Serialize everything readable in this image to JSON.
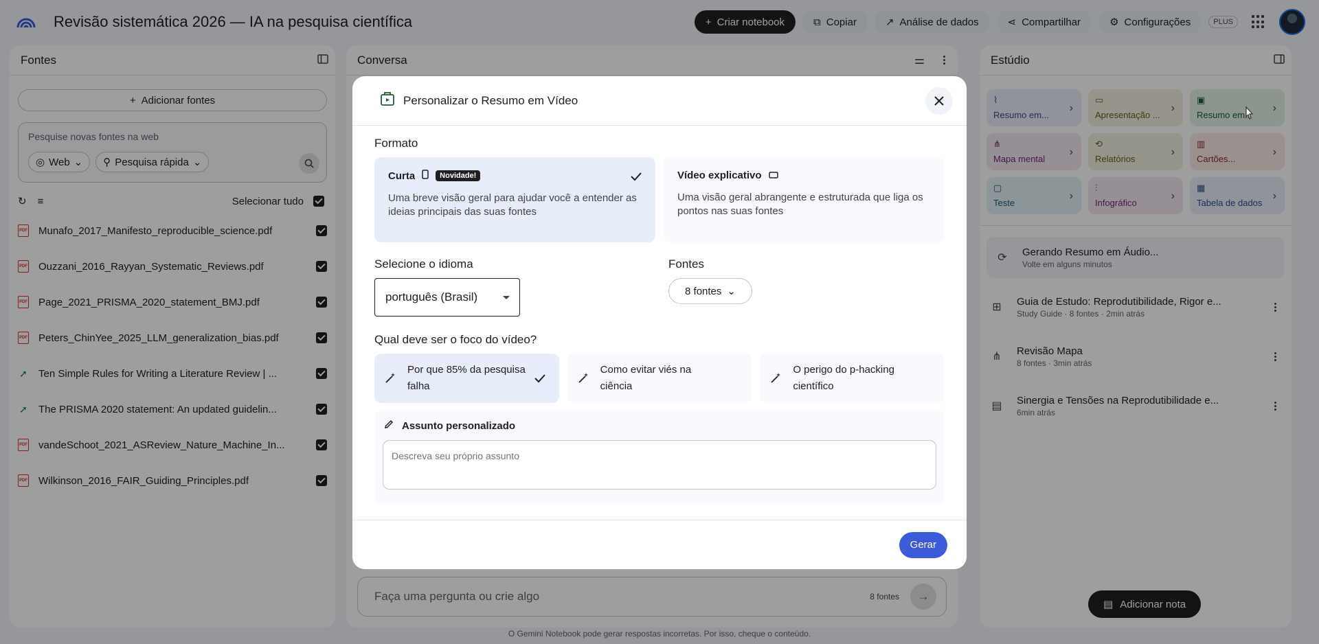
{
  "header": {
    "title": "Revisão sistemática 2026 — IA na pesquisa científica",
    "create_notebook": "Criar notebook",
    "copy": "Copiar",
    "data_analysis": "Análise de dados",
    "share": "Compartilhar",
    "settings": "Configurações",
    "plan_badge": "PLUS"
  },
  "sources_panel": {
    "title": "Fontes",
    "add_sources": "Adicionar fontes",
    "search_placeholder": "Pesquise novas fontes na web",
    "web_chip": "Web",
    "mode_chip": "Pesquisa rápida",
    "select_all": "Selecionar tudo",
    "items": [
      {
        "name": "Munafo_2017_Manifesto_reproducible_science.pdf",
        "kind": "pdf"
      },
      {
        "name": "Ouzzani_2016_Rayyan_Systematic_Reviews.pdf",
        "kind": "pdf"
      },
      {
        "name": "Page_2021_PRISMA_2020_statement_BMJ.pdf",
        "kind": "pdf"
      },
      {
        "name": "Peters_ChinYee_2025_LLM_generalization_bias.pdf",
        "kind": "pdf"
      },
      {
        "name": "Ten Simple Rules for Writing a Literature Review | ...",
        "kind": "web"
      },
      {
        "name": "The PRISMA 2020 statement: An updated guidelin...",
        "kind": "web"
      },
      {
        "name": "vandeSchoot_2021_ASReview_Nature_Machine_In...",
        "kind": "pdf"
      },
      {
        "name": "Wilkinson_2016_FAIR_Guiding_Principles.pdf",
        "kind": "pdf"
      }
    ]
  },
  "chat_panel": {
    "title": "Conversa",
    "input_placeholder": "Faça uma pergunta ou crie algo",
    "source_count": "8 fontes"
  },
  "studio_panel": {
    "title": "Estúdio",
    "tiles": [
      {
        "label": "Resumo em...",
        "bg": "#e9eef9",
        "fg": "#3c4a8c"
      },
      {
        "label": "Apresentação ...",
        "bg": "#f4f0e0",
        "fg": "#6b5a1e"
      },
      {
        "label": "Resumo em...",
        "bg": "#e3f1e6",
        "fg": "#1e5b2f"
      },
      {
        "label": "Mapa mental",
        "bg": "#f3e8f3",
        "fg": "#6e2a6e"
      },
      {
        "label": "Relatórios",
        "bg": "#f2f0e0",
        "fg": "#6b5a1e"
      },
      {
        "label": "Cartões...",
        "bg": "#f8e8e6",
        "fg": "#8c2b22"
      },
      {
        "label": "Teste",
        "bg": "#e3f1f6",
        "fg": "#1e5872"
      },
      {
        "label": "Infográfico",
        "bg": "#f3e8f3",
        "fg": "#6e2a6e"
      },
      {
        "label": "Tabela de dados",
        "bg": "#e8eef9",
        "fg": "#2f4a8c"
      }
    ],
    "generating": {
      "title": "Gerando Resumo em Áudio...",
      "sub": "Volte em alguns minutos"
    },
    "notes": [
      {
        "title": "Guia de Estudo: Reprodutibilidade, Rigor e...",
        "sub": "Study Guide · 8 fontes · 2min atrás"
      },
      {
        "title": "Revisão Mapa",
        "sub": "8 fontes · 3min atrás"
      },
      {
        "title": "Sinergia e Tensões na Reprodutibilidade e...",
        "sub": "6min atrás"
      }
    ],
    "add_note": "Adicionar nota"
  },
  "footer": "O Gemini Notebook pode gerar respostas incorretas. Por isso, cheque o conteúdo.",
  "modal": {
    "title": "Personalizar o Resumo em Vídeo",
    "format_label": "Formato",
    "formats": [
      {
        "name": "Curta",
        "badge": "Novidade!",
        "desc": "Uma breve visão geral para ajudar você a entender as ideias principais das suas fontes",
        "selected": true
      },
      {
        "name": "Vídeo explicativo",
        "desc": "Uma visão geral abrangente e estruturada que liga os pontos nas suas fontes",
        "selected": false
      }
    ],
    "language_label": "Selecione o idioma",
    "language_value": "português (Brasil)",
    "sources_label": "Fontes",
    "sources_value": "8 fontes",
    "focus_label": "Qual deve ser o foco do vídeo?",
    "focus_options": [
      {
        "text": "Por que 85% da pesquisa falha",
        "selected": true
      },
      {
        "text": "Como evitar viés na ciência",
        "selected": false
      },
      {
        "text": "O perigo do p-hacking científico",
        "selected": false
      }
    ],
    "custom_label": "Assunto personalizado",
    "custom_placeholder": "Descreva seu próprio assunto",
    "generate": "Gerar"
  }
}
